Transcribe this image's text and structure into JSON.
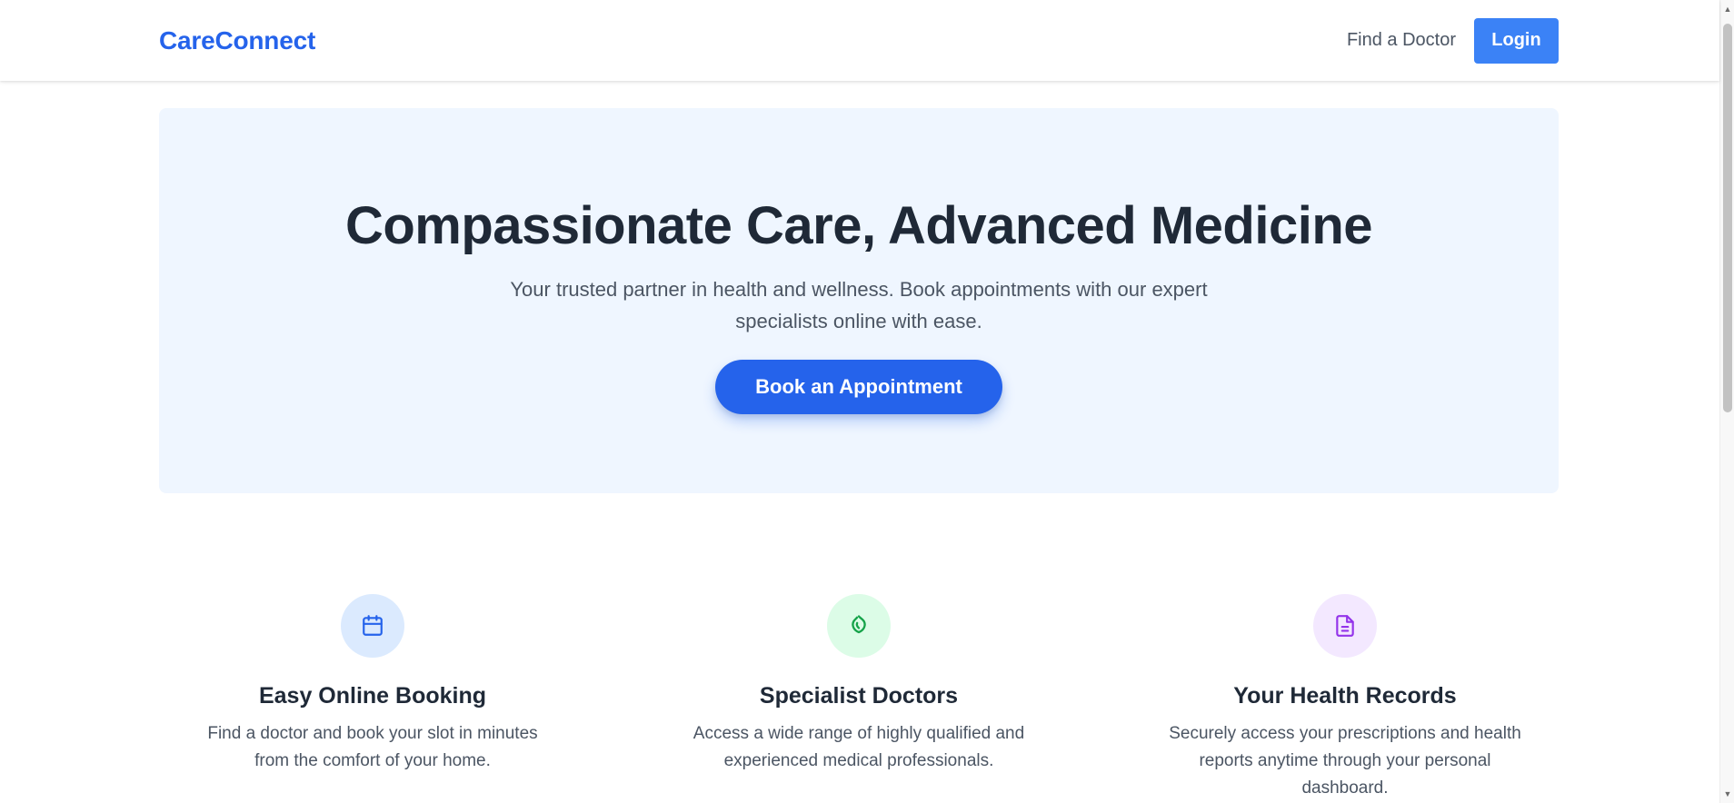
{
  "header": {
    "brand": "CareConnect",
    "nav_link": "Find a Doctor",
    "login_label": "Login"
  },
  "hero": {
    "title": "Compassionate Care, Advanced Medicine",
    "subtitle": "Your trusted partner in health and wellness. Book appointments with our expert specialists online with ease.",
    "cta_label": "Book an Appointment"
  },
  "features": [
    {
      "icon": "calendar-icon",
      "title": "Easy Online Booking",
      "description": "Find a doctor and book your slot in minutes from the comfort of your home."
    },
    {
      "icon": "doctor-icon",
      "title": "Specialist Doctors",
      "description": "Access a wide range of highly qualified and experienced medical professionals."
    },
    {
      "icon": "document-icon",
      "title": "Your Health Records",
      "description": "Securely access your prescriptions and health reports anytime through your personal dashboard."
    }
  ],
  "colors": {
    "brand": "#2563eb",
    "login_button": "#3b82f6",
    "hero_background": "#eff6ff",
    "icon_blue_bg": "#dbeafe",
    "icon_green_bg": "#dcfce7",
    "icon_purple_bg": "#f3e8ff"
  }
}
